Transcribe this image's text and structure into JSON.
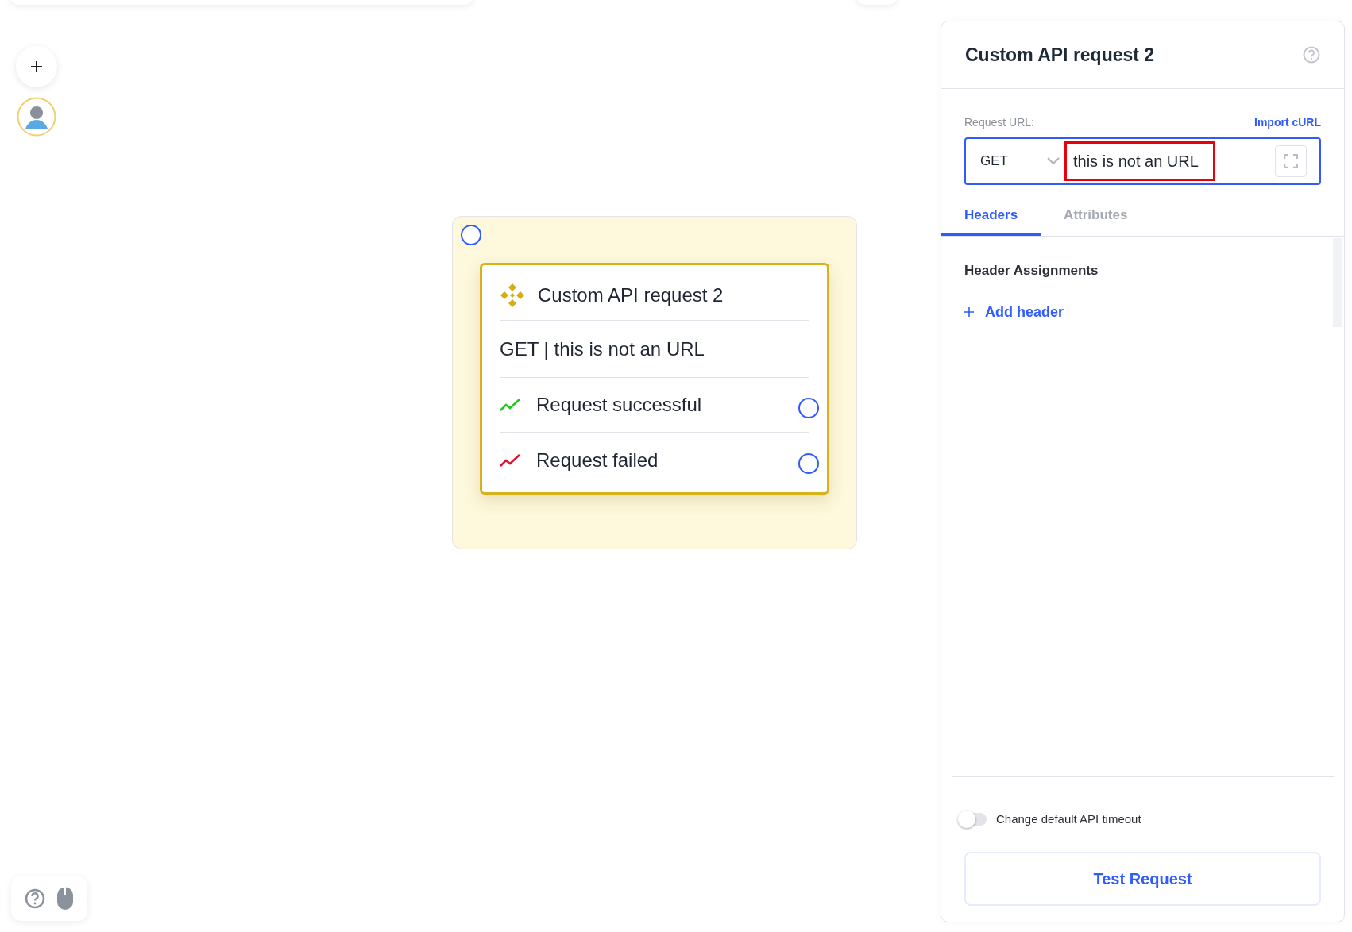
{
  "node": {
    "title": "Custom API request 2",
    "summary": "GET | this is not an URL",
    "outputs": [
      {
        "label": "Request successful",
        "kind": "success"
      },
      {
        "label": "Request failed",
        "kind": "failure"
      }
    ]
  },
  "panel": {
    "title": "Custom API request 2",
    "request_url_label": "Request URL:",
    "import_link": "Import cURL",
    "method": "GET",
    "url": "this is not an URL",
    "url_invalid": true,
    "tabs": [
      {
        "label": "Headers",
        "selected": true
      },
      {
        "label": "Attributes",
        "selected": false
      }
    ],
    "section_title": "Header Assignments",
    "add_header": "Add header",
    "timeout_toggle": {
      "label": "Change default API timeout",
      "on": false
    },
    "test_button": "Test Request"
  }
}
